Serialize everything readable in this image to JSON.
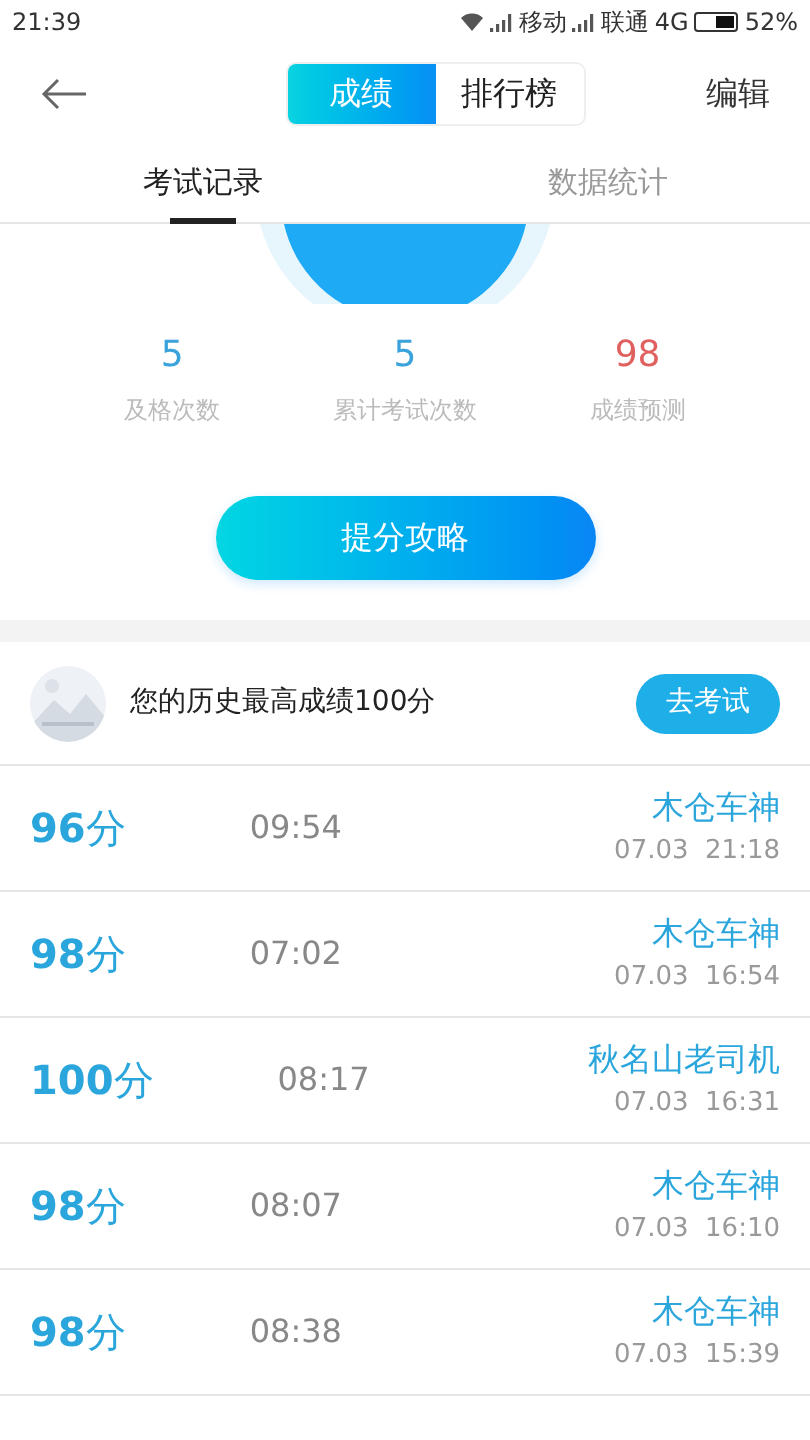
{
  "status_bar": {
    "time": "21:39",
    "carrier_1": "移动",
    "carrier_2": "联通",
    "network": "4G",
    "battery": "52%"
  },
  "header": {
    "segments": [
      {
        "label": "成绩",
        "selected": true
      },
      {
        "label": "排行榜",
        "selected": false
      }
    ],
    "edit": "编辑"
  },
  "tabs": [
    {
      "label": "考试记录",
      "selected": true
    },
    {
      "label": "数据统计",
      "selected": false
    }
  ],
  "stats": [
    {
      "value": "5",
      "label": "及格次数",
      "color": "#3aa3dc"
    },
    {
      "value": "5",
      "label": "累计考试次数",
      "color": "#3aa3dc"
    },
    {
      "value": "98",
      "label": "成绩预测",
      "color": "#e0605f"
    }
  ],
  "tips_button": "提分攻略",
  "best": {
    "text": "您的历史最高成绩100分",
    "button": "去考试"
  },
  "records": [
    {
      "score": "**96**分",
      "duration": "09:54",
      "name": "木仓车神",
      "date": "07.03  21:18"
    },
    {
      "score": "**98**分",
      "duration": "07:02",
      "name": "木仓车神",
      "date": "07.03  16:54"
    },
    {
      "score": "**100**分",
      "duration": "08:17",
      "name": "秋名山老司机",
      "date": "07.03  16:31"
    },
    {
      "score": "**98**分",
      "duration": "08:07",
      "name": "木仓车神",
      "date": "07.03  16:10"
    },
    {
      "score": "**98**分",
      "duration": "08:38",
      "name": "木仓车神",
      "date": "07.03  15:39"
    }
  ]
}
